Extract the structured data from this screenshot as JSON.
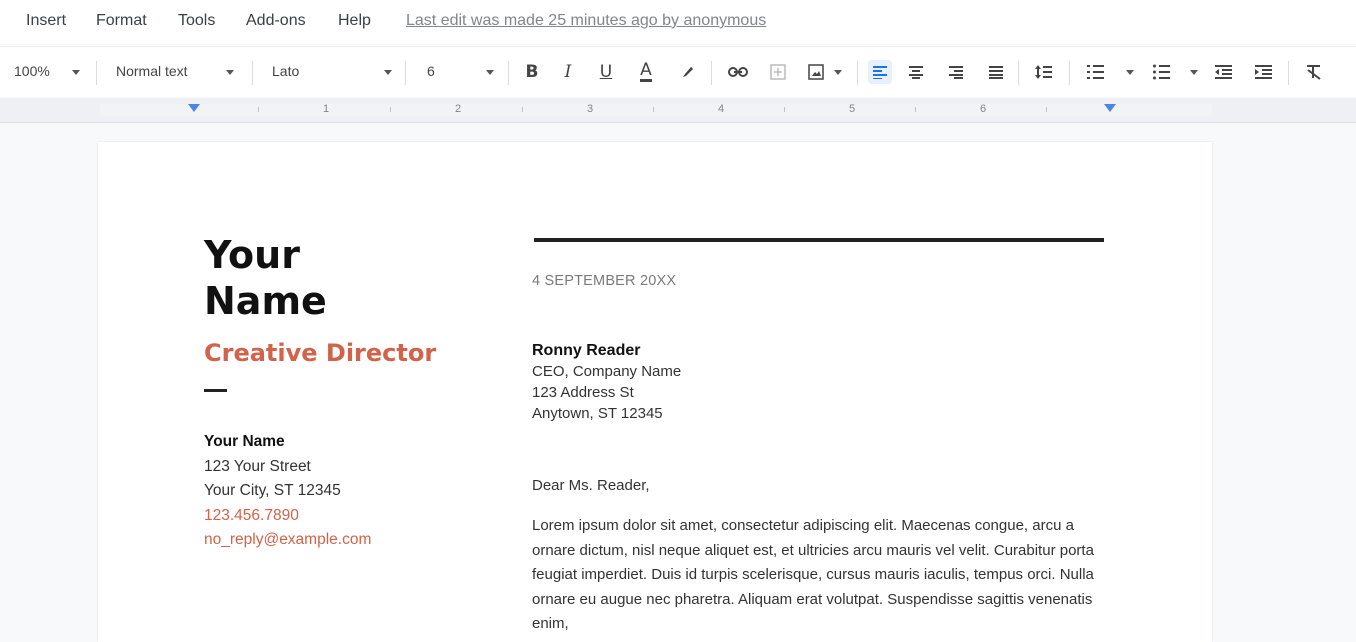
{
  "menu": {
    "items": [
      "Insert",
      "Format",
      "Tools",
      "Add-ons",
      "Help"
    ],
    "last_edit": "Last edit was made 25 minutes ago by anonymous"
  },
  "toolbar": {
    "zoom": "100%",
    "style": "Normal text",
    "font": "Lato",
    "font_size": "6",
    "bold": "B",
    "italic": "I",
    "underline": "U",
    "text_color": "A"
  },
  "ruler": {
    "numbers": [
      "1",
      "2",
      "3",
      "4",
      "5",
      "6"
    ]
  },
  "document": {
    "name_line1": "Your",
    "name_line2": "Name",
    "job_title": "Creative Director",
    "sender_name": "Your Name",
    "sender_street": "123 Your Street",
    "sender_city": "Your City, ST 12345",
    "sender_phone": "123.456.7890",
    "sender_email": "no_reply@example.com",
    "date": "4 SEPTEMBER 20XX",
    "recipient_name": "Ronny Reader",
    "recipient_title": "CEO, Company Name",
    "recipient_street": "123 Address St",
    "recipient_city": "Anytown, ST 12345",
    "greeting": "Dear Ms. Reader,",
    "body": "Lorem ipsum dolor sit amet, consectetur adipiscing elit. Maecenas congue, arcu a ornare dictum, nisl neque aliquet est, et ultricies arcu mauris vel velit. Curabitur porta feugiat imperdiet. Duis id turpis scelerisque, cursus mauris iaculis, tempus orci. Nulla ornare eu augue nec pharetra. Aliquam erat volutpat. Suspendisse sagittis venenatis enim,"
  },
  "colors": {
    "accent": "#d2634a",
    "link_blue": "#4a86e8"
  }
}
